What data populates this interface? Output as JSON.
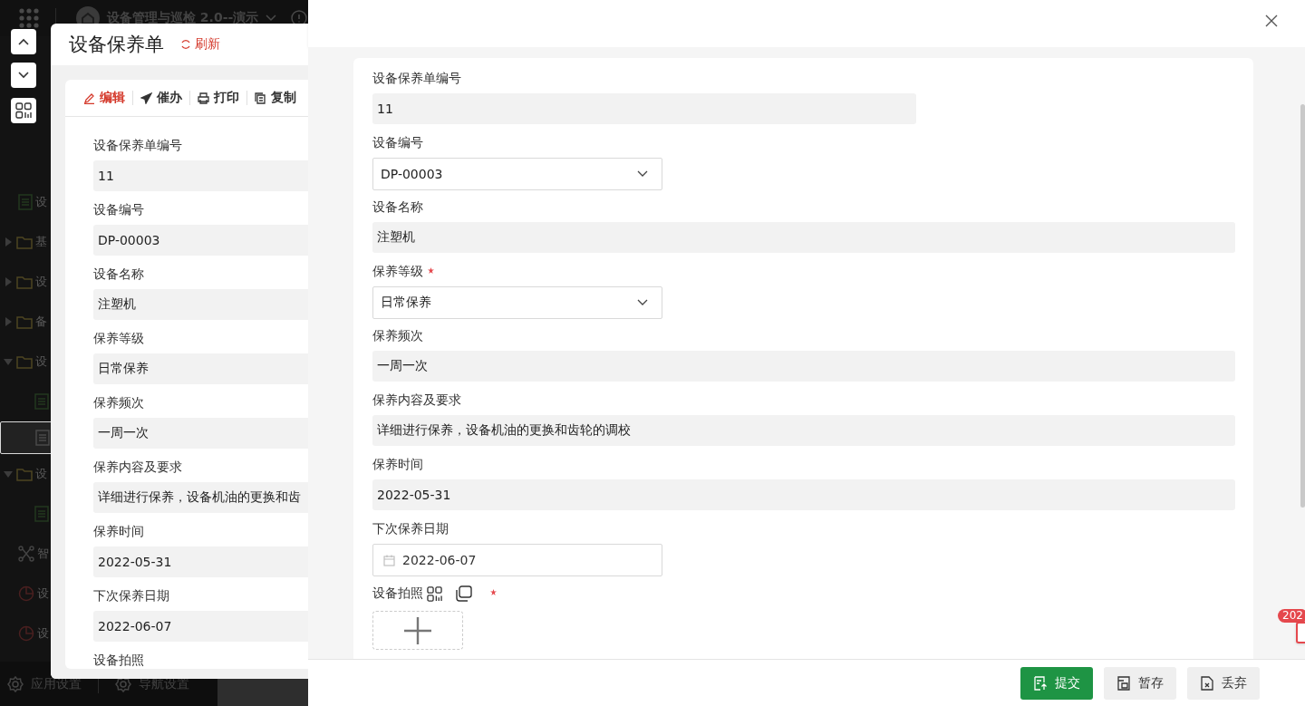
{
  "app": {
    "title": "设备管理与巡检 2.0--演示",
    "sidebar": [
      {
        "kind": "doc",
        "text": "设",
        "selected": false
      },
      {
        "kind": "folder",
        "text": "基",
        "selected": false,
        "expanded": false
      },
      {
        "kind": "folder",
        "text": "设",
        "selected": false,
        "expanded": false
      },
      {
        "kind": "folder",
        "text": "备",
        "selected": false,
        "expanded": false
      },
      {
        "kind": "folder",
        "text": "设",
        "selected": false,
        "expanded": true,
        "children": [
          {
            "kind": "doc",
            "selected": false
          },
          {
            "kind": "doc",
            "selected": true
          }
        ]
      },
      {
        "kind": "folder",
        "text": "设",
        "selected": false,
        "expanded": true,
        "children": [
          {
            "kind": "doc",
            "selected": false
          }
        ]
      },
      {
        "kind": "flow",
        "text": "智",
        "selected": false
      },
      {
        "kind": "chart",
        "text": "设",
        "selected": false
      },
      {
        "kind": "chart",
        "text": "设",
        "selected": false
      }
    ],
    "footer": [
      "应用设置",
      "导航设置"
    ]
  },
  "record_window": {
    "title": "设备保养单",
    "refresh": "刷新",
    "toolbar": [
      {
        "label": "编辑",
        "kind": "edit",
        "selected": true
      },
      {
        "label": "催办",
        "kind": "send",
        "selected": false
      },
      {
        "label": "打印",
        "kind": "print",
        "selected": false
      },
      {
        "label": "复制",
        "kind": "copy",
        "selected": false
      }
    ],
    "fields": [
      {
        "label": "设备保养单编号",
        "value": "11"
      },
      {
        "label": "设备编号",
        "value": "DP-00003"
      },
      {
        "label": "设备名称",
        "value": "注塑机"
      },
      {
        "label": "保养等级",
        "value": "日常保养"
      },
      {
        "label": "保养频次",
        "value": "一周一次"
      },
      {
        "label": "保养内容及要求",
        "value": "详细进行保养，设备机油的更换和齿"
      },
      {
        "label": "保养时间",
        "value": "2022-05-31"
      },
      {
        "label": "下次保养日期",
        "value": "2022-06-07"
      },
      {
        "label": "设备拍照"
      }
    ]
  },
  "drawer": {
    "fields": [
      {
        "kind": "serial",
        "label": "设备保养单编号",
        "value": "11",
        "required": false
      },
      {
        "kind": "select",
        "label": "设备编号",
        "value": "DP-00003",
        "required": false
      },
      {
        "kind": "text",
        "label": "设备名称",
        "value": "注塑机",
        "required": false
      },
      {
        "kind": "select",
        "label": "保养等级",
        "value": "日常保养",
        "required": true
      },
      {
        "kind": "text",
        "label": "保养频次",
        "value": "一周一次",
        "required": false
      },
      {
        "kind": "text",
        "label": "保养内容及要求",
        "value": "详细进行保养，设备机油的更换和齿轮的调校",
        "required": false
      },
      {
        "kind": "text",
        "label": "保养时间",
        "value": "2022-05-31",
        "required": false
      },
      {
        "kind": "date",
        "label": "下次保养日期",
        "value": "2022-06-07",
        "required": false
      },
      {
        "kind": "upload",
        "label": "设备拍照",
        "required": true
      }
    ],
    "buttons": [
      {
        "label": "提交",
        "kind": "primary"
      },
      {
        "label": "暂存",
        "kind": "save"
      },
      {
        "label": "丢弃",
        "kind": "discard"
      }
    ]
  },
  "badge": "202"
}
